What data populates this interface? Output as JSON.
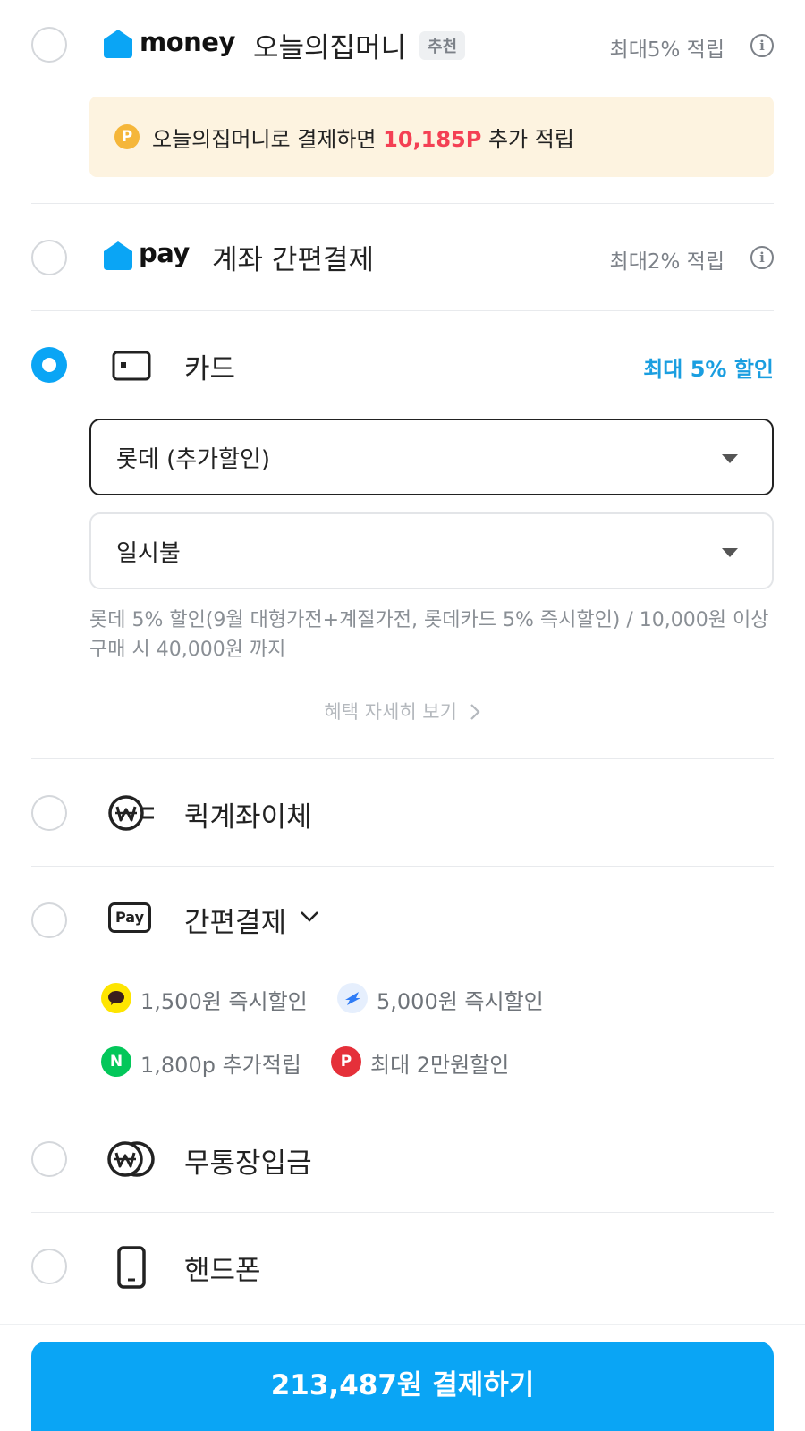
{
  "methods": {
    "money": {
      "logo_word": "money",
      "label": "오늘의집머니",
      "badge": "추천",
      "reward": "최대5% 적립",
      "promo_prefix": "오늘의집머니로 결제하면 ",
      "promo_highlight": "10,185P",
      "promo_suffix": " 추가 적립",
      "promo_coin": "P"
    },
    "pay": {
      "logo_word": "pay",
      "label": "계좌 간편결제",
      "reward": "최대2% 적립"
    },
    "card": {
      "label": "카드",
      "discount": "최대 5% 할인",
      "card_select_value": "롯데 (추가할인)",
      "installment_select_value": "일시불",
      "description": "롯데 5% 할인(9월 대형가전+계절가전, 롯데카드 5% 즉시할인) / 10,000원 이상 구매 시 40,000원 까지",
      "more_link": "혜택 자세히 보기"
    },
    "quick_transfer": {
      "label": "퀵계좌이체"
    },
    "easy_pay": {
      "label": "간편결제",
      "icon_text": "Pay",
      "offers": [
        {
          "icon": "kakao-pay-icon",
          "text": "1,500원 즉시할인"
        },
        {
          "icon": "toss-pay-icon",
          "text": "5,000원 즉시할인"
        },
        {
          "icon": "naver-pay-icon",
          "icon_text": "N",
          "text": "1,800p 추가적립"
        },
        {
          "icon": "payco-icon",
          "icon_text": "P",
          "text": "최대 2만원할인"
        }
      ]
    },
    "bank_deposit": {
      "label": "무통장입금"
    },
    "phone": {
      "label": "핸드폰"
    }
  },
  "pay_button": {
    "label": "213,487원 결제하기"
  },
  "colors": {
    "accent": "#0aa5f5",
    "promo_highlight": "#f44054",
    "promo_bg": "#fdf3e0",
    "coin": "#f5b63a",
    "kakao": "#fee500",
    "naver": "#03c75a",
    "payco": "#e5303a"
  }
}
